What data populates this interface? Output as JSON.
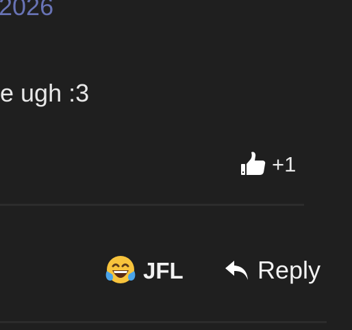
{
  "post": {
    "date_fragment": "2026",
    "text_fragment": "e ugh :3"
  },
  "reaction": {
    "icon": "thumbs-up-icon",
    "count": "+1"
  },
  "actions": {
    "laugh_icon": "laughing-crying-emoji-icon",
    "laugh_label": "JFL",
    "reply_icon": "reply-arrow-icon",
    "reply_label": "Reply"
  },
  "colors": {
    "background": "#1f1f1f",
    "date_text": "#6873b5",
    "body_text": "#e8e8e8",
    "divider": "#2c2c2c"
  }
}
